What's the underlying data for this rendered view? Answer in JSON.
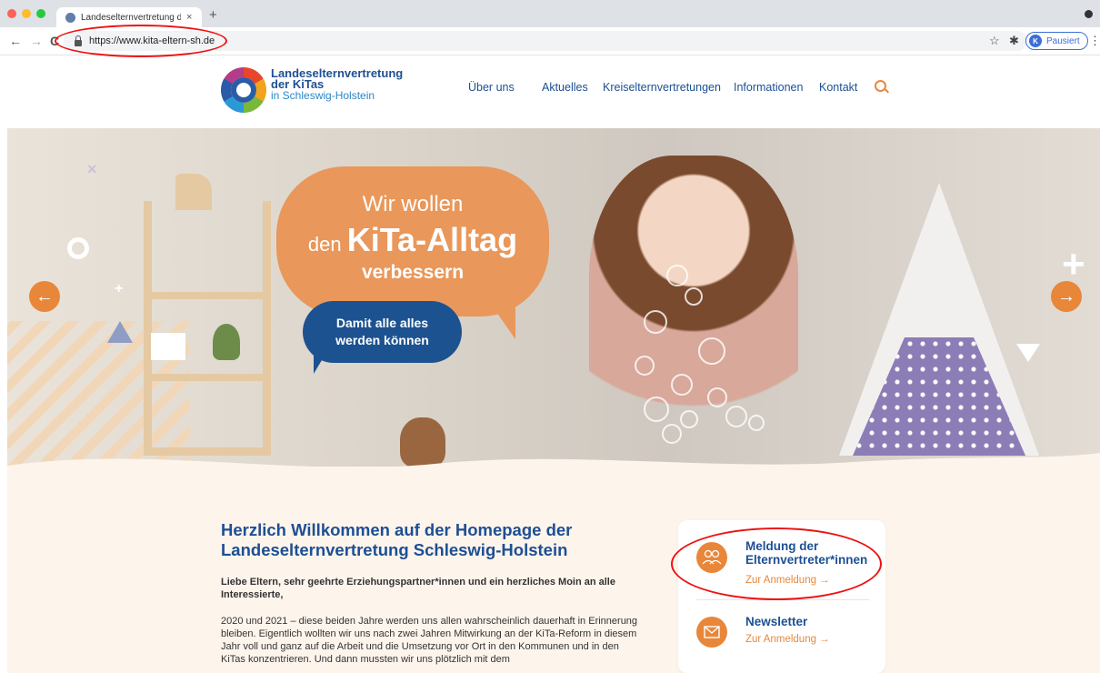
{
  "browser": {
    "tab_title": "Landeselternvertretung der KiTas",
    "tab_close": "×",
    "new_tab": "+",
    "url": "https://www.kita-eltern-sh.de",
    "profile_initial": "K",
    "profile_label": "Pausiert",
    "back": "←",
    "forward": "→",
    "reload": "C",
    "star": "☆",
    "extension": "✱",
    "menu": "⋮"
  },
  "site": {
    "brand_line1": "Landeselternvertretung",
    "brand_line2": "der KiTas",
    "brand_line3": "in Schleswig-Holstein",
    "nav": [
      "Über uns",
      "Aktuelles",
      "Kreiselternvertretungen",
      "Informationen",
      "Kontakt"
    ]
  },
  "hero": {
    "bubble_line1": "Wir wollen",
    "bubble_line2_prefix": "den ",
    "bubble_line2_bold": "KiTa-Alltag",
    "bubble_line3": "verbessern",
    "blue_line1": "Damit alle alles",
    "blue_line2": "werden können",
    "prev_arrow": "←",
    "next_arrow": "→"
  },
  "welcome": {
    "heading_line1": "Herzlich Willkommen auf der Homepage der",
    "heading_line2": "Landeselternvertretung Schleswig-Holstein",
    "intro": "Liebe Eltern, sehr geehrte Erziehungspartner*innen und ein herzliches Moin an alle Interessierte,",
    "paragraph": "2020 und 2021 – diese beiden Jahre werden uns allen wahrscheinlich dauerhaft in Erinnerung bleiben. Eigentlich wollten wir uns nach zwei Jahren Mitwirkung an der KiTa-Reform in diesem Jahr voll und ganz auf die Arbeit und die Umsetzung vor Ort in den Kommunen und in den KiTas konzentrieren. Und dann mussten wir uns plötzlich mit dem"
  },
  "cards": [
    {
      "title_line1": "Meldung der",
      "title_line2": "Elternvertreter*innen",
      "link": "Zur Anmeldung →"
    },
    {
      "title_line1": "Newsletter",
      "link": "Zur Anmeldung →"
    }
  ],
  "colors": {
    "accent_orange": "#e8873a",
    "brand_blue": "#1d4f93",
    "annotation_red": "#e11111"
  }
}
